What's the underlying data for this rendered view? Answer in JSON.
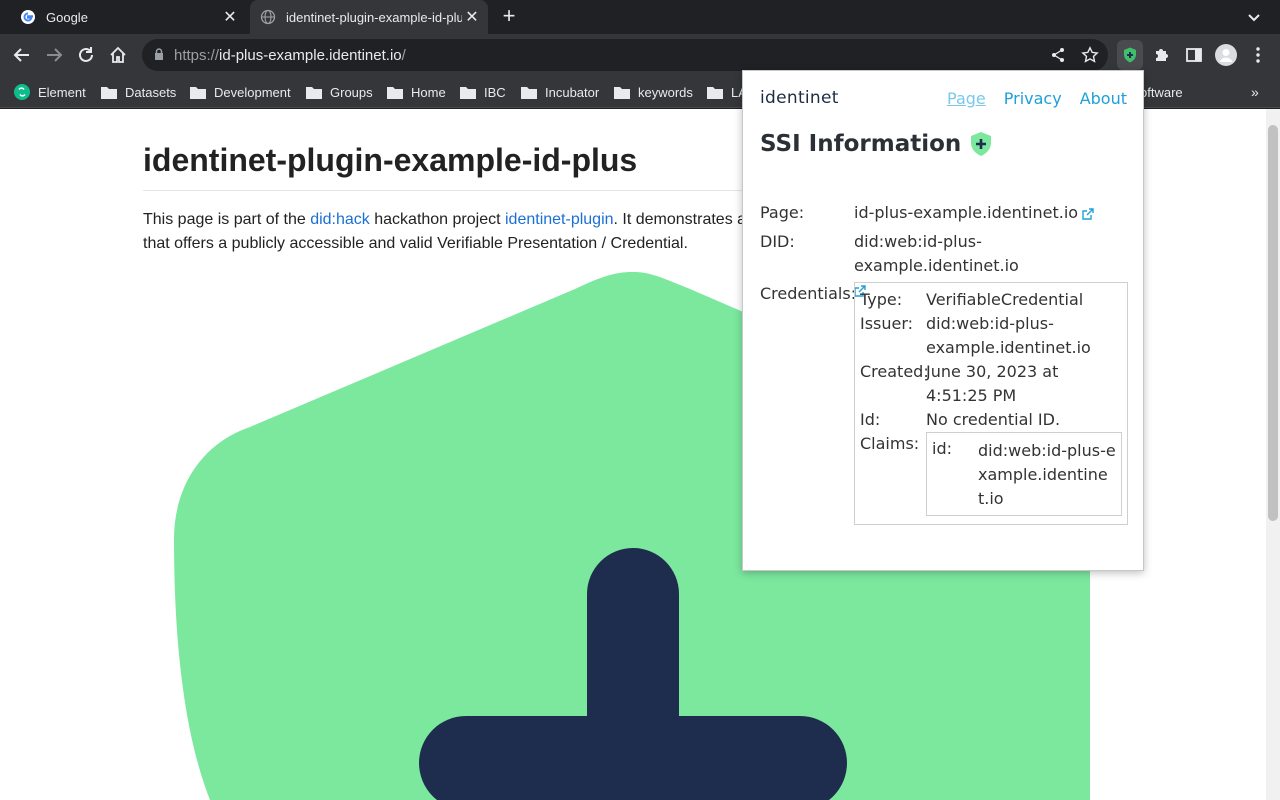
{
  "browser": {
    "tabs": [
      {
        "title": "Google",
        "active": false
      },
      {
        "title": "identinet-plugin-example-id-plu",
        "active": true
      }
    ],
    "url": {
      "scheme": "https://",
      "host": "id-plus-example.identinet.io",
      "path": "/"
    },
    "bookmarks": [
      "Element",
      "Datasets",
      "Development",
      "Groups",
      "Home",
      "IBC",
      "Incubator",
      "keywords",
      "LA",
      "oftware"
    ]
  },
  "page": {
    "heading": "identinet-plugin-example-id-plus",
    "intro": {
      "text1": "This page is part of the ",
      "link1": "did:hack",
      "text2": " hackathon project ",
      "link2": "identinet-plugin",
      "text3": ". It demonstrates a",
      "line2": "that offers a publicly accessible and valid Verifiable Presentation / Credential."
    },
    "logo_colors": {
      "shield": "#7be89e",
      "plus": "#1e2d4d"
    }
  },
  "popup": {
    "brand": "identinet",
    "nav": [
      "Page",
      "Privacy",
      "About"
    ],
    "title": "SSI Information",
    "page_label": "Page:",
    "page_value": "id-plus-example.identinet.io",
    "did_label": "DID:",
    "did_value": "did:web:id-plus-example.identinet.io",
    "credentials_label": "Credentials:",
    "credential": {
      "type_label": "Type:",
      "type_value": "VerifiableCredential",
      "issuer_label": "Issuer:",
      "issuer_value": "did:web:id-plus-example.identinet.io",
      "created_label": "Created:",
      "created_value": "June 30, 2023 at 4:51:25 PM",
      "id_label": "Id:",
      "id_value": "No credential ID.",
      "claims_label": "Claims:",
      "claim_key": "id:",
      "claim_value": "did:web:id-plus-example.identinet.io"
    }
  }
}
